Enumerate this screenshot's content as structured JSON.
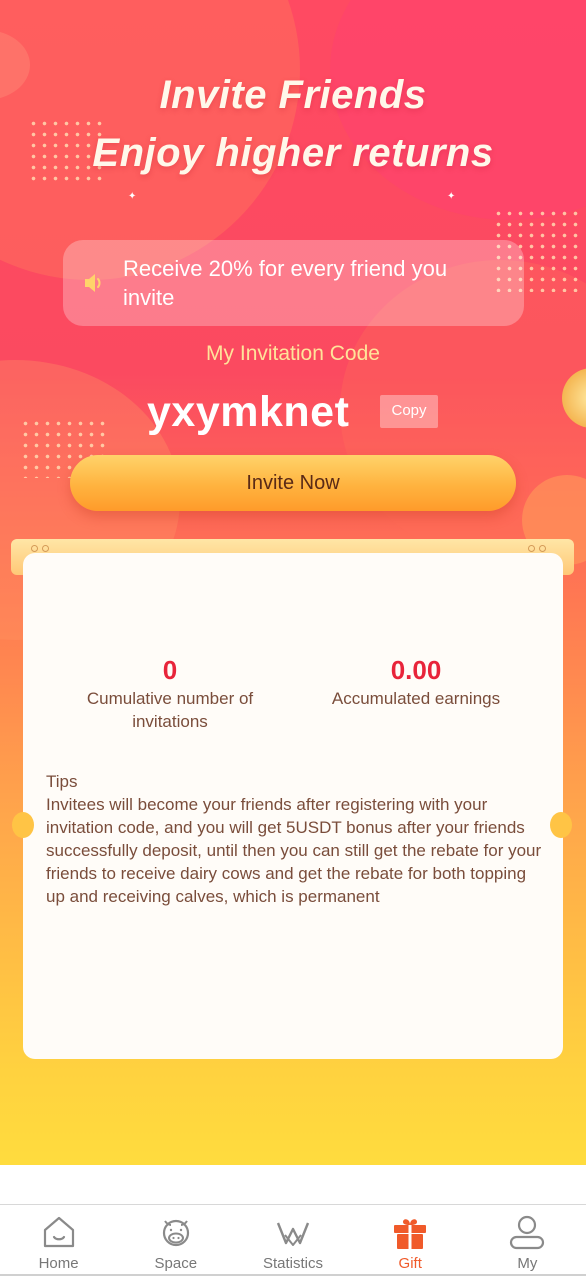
{
  "header": {
    "title_line1": "Invite Friends",
    "title_line2": "Enjoy higher returns"
  },
  "notice": {
    "icon": "speaker-icon",
    "text": "Receive 20% for every friend you invite"
  },
  "invitation": {
    "label": "My Invitation Code",
    "code": "yxymknet",
    "copy_label": "Copy",
    "invite_button": "Invite Now"
  },
  "stats": [
    {
      "value": "0",
      "label": "Cumulative number of invitations"
    },
    {
      "value": "0.00",
      "label": "Accumulated earnings"
    }
  ],
  "tips": {
    "heading": "Tips",
    "body": "Invitees will become your friends after registering with your invitation code, and you will get 5USDT bonus after your friends successfully deposit, until then you can still get the rebate for your friends to receive dairy cows and get the rebate for both topping up and receiving calves, which is permanent"
  },
  "tabbar": {
    "items": [
      {
        "label": "Home",
        "icon": "home-icon"
      },
      {
        "label": "Space",
        "icon": "cow-icon"
      },
      {
        "label": "Statistics",
        "icon": "statistics-icon"
      },
      {
        "label": "Gift",
        "icon": "gift-icon"
      },
      {
        "label": "My",
        "icon": "user-icon"
      }
    ],
    "active": "Gift",
    "active_color": "#f05a2a"
  },
  "colors": {
    "accent_red": "#e8243a",
    "code_label": "#ffe39a"
  }
}
